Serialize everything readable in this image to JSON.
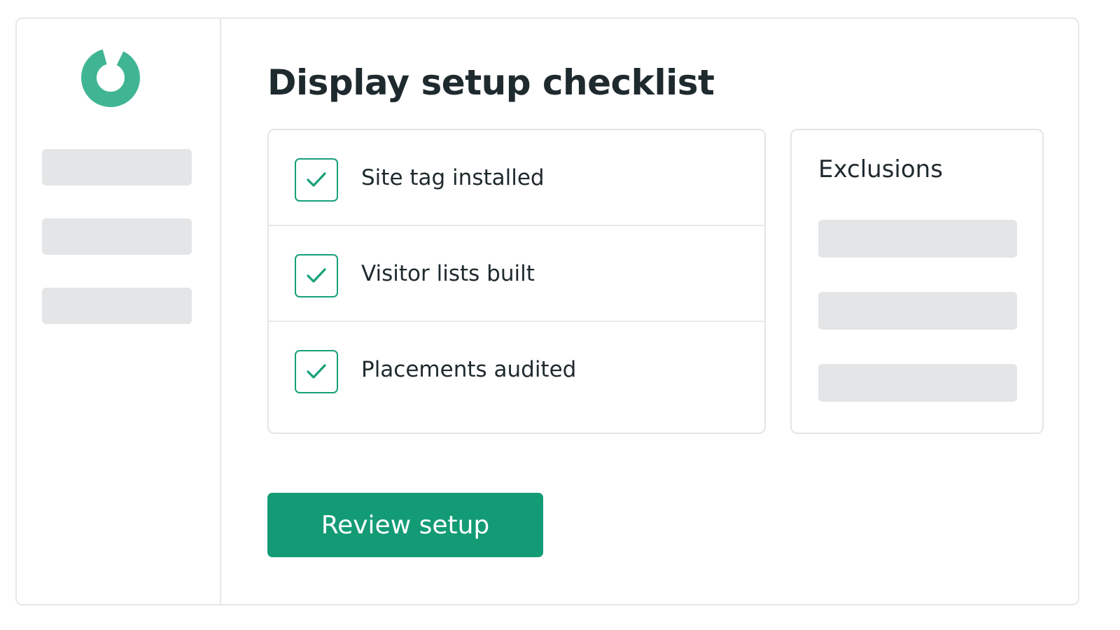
{
  "app": {
    "logo_icon": "ring-logo-icon",
    "accent_color": "#139b76"
  },
  "main": {
    "title": "Display setup checklist",
    "checklist": {
      "items": [
        {
          "label": "Site tag installed",
          "checked": true,
          "icon": "check-icon"
        },
        {
          "label": "Visitor lists built",
          "checked": true,
          "icon": "check-icon"
        },
        {
          "label": "Placements audited",
          "checked": true,
          "icon": "check-icon"
        }
      ]
    },
    "exclusions": {
      "title": "Exclusions"
    },
    "review_button_label": "Review setup"
  }
}
